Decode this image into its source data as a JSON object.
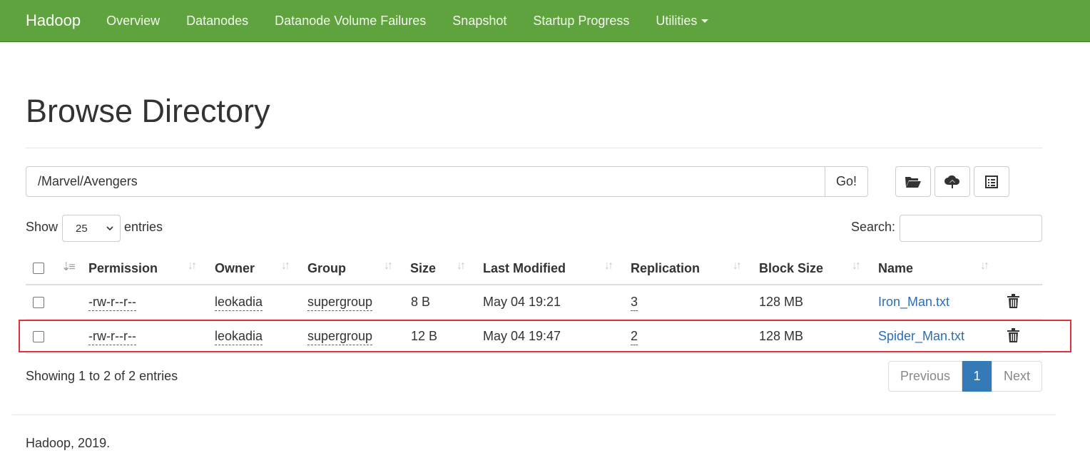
{
  "navbar": {
    "brand": "Hadoop",
    "items": [
      "Overview",
      "Datanodes",
      "Datanode Volume Failures",
      "Snapshot",
      "Startup Progress",
      "Utilities"
    ],
    "bg_color": "#5fa33e"
  },
  "page": {
    "title": "Browse Directory"
  },
  "path_bar": {
    "value": "/Marvel/Avengers",
    "go_label": "Go!",
    "tools": [
      "folder-open-icon",
      "cloud-upload-icon",
      "list-icon"
    ]
  },
  "table_controls": {
    "show_label": "Show",
    "page_length": "25",
    "entries_label": "entries",
    "search_label": "Search:",
    "search_value": ""
  },
  "table": {
    "columns": [
      "Permission",
      "Owner",
      "Group",
      "Size",
      "Last Modified",
      "Replication",
      "Block Size",
      "Name"
    ],
    "rows": [
      {
        "permission": "-rw-r--r--",
        "owner": "leokadia",
        "group": "supergroup",
        "size": "8 B",
        "modified": "May 04 19:21",
        "replication": "3",
        "block_size": "128 MB",
        "name": "Iron_Man.txt",
        "highlighted": false
      },
      {
        "permission": "-rw-r--r--",
        "owner": "leokadia",
        "group": "supergroup",
        "size": "12 B",
        "modified": "May 04 19:47",
        "replication": "2",
        "block_size": "128 MB",
        "name": "Spider_Man.txt",
        "highlighted": true
      }
    ]
  },
  "table_footer": {
    "info": "Showing 1 to 2 of 2 entries",
    "previous": "Previous",
    "current_page": "1",
    "next": "Next"
  },
  "footer": {
    "text": "Hadoop, 2019."
  },
  "colors": {
    "link": "#2a6fb5",
    "highlight_border": "#e0323a",
    "active_page": "#337ab7"
  }
}
